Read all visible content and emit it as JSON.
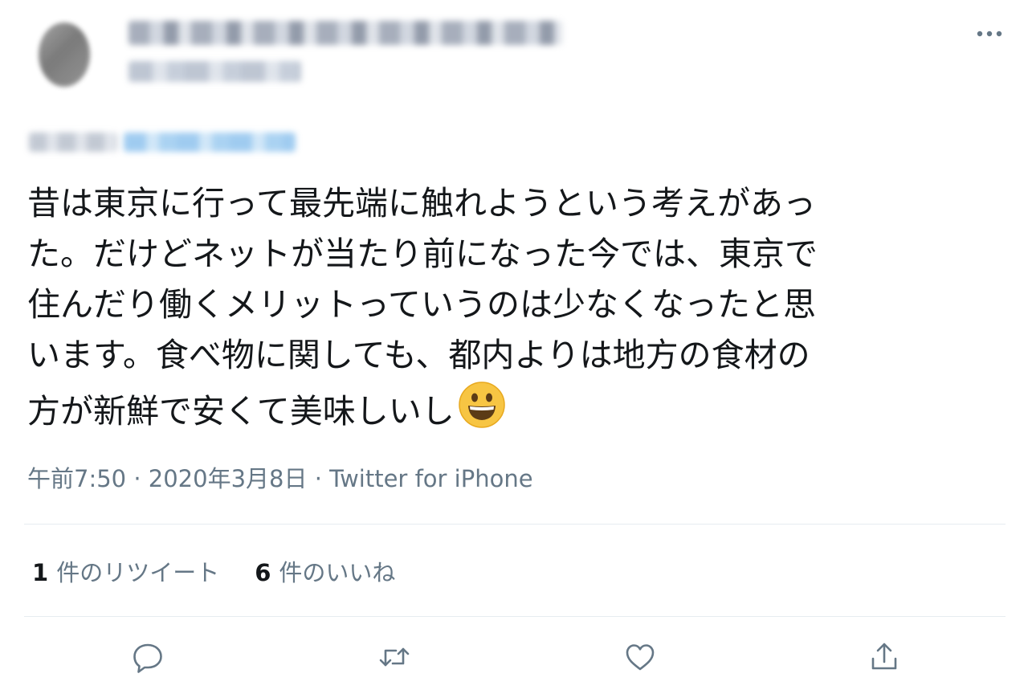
{
  "header": {
    "more_icon": "more-horizontal-icon"
  },
  "tweet": {
    "text_lines": [
      "昔は東京に行って最先端に触れようという考えがあっ",
      "た。だけどネットが当たり前になった今では、東京で",
      "住んだり働くメリットっていうのは少なくなったと思",
      "います。食べ物に関しても、都内よりは地方の食材の",
      "方が新鮮で安くて美味しいし"
    ],
    "emoji": "grinning-face"
  },
  "meta": {
    "time": "午前7:50",
    "sep1": " · ",
    "date": "2020年3月8日",
    "sep2": " · ",
    "source": "Twitter for iPhone"
  },
  "stats": {
    "retweets_count": "1",
    "retweets_label": "件のリツイート",
    "likes_count": "6",
    "likes_label": "件のいいね"
  },
  "actions": [
    {
      "name": "reply",
      "icon": "reply-icon"
    },
    {
      "name": "retweet",
      "icon": "retweet-icon"
    },
    {
      "name": "like",
      "icon": "heart-icon"
    },
    {
      "name": "share",
      "icon": "share-icon"
    }
  ],
  "colors": {
    "text": "#14171a",
    "secondary": "#657786",
    "divider": "#e6ecf0",
    "icon": "#657786",
    "mention_blue": "#1da1f2"
  }
}
